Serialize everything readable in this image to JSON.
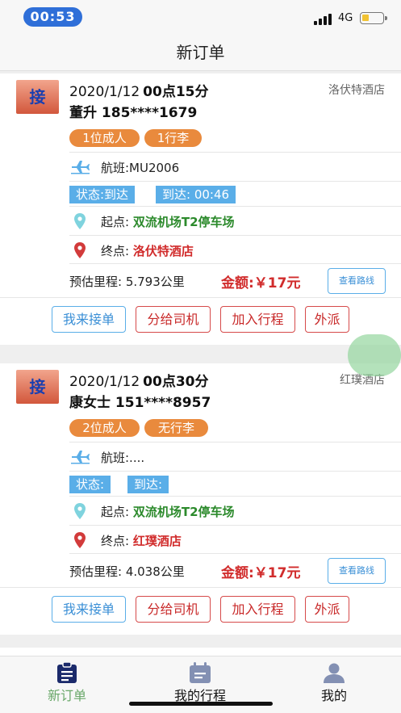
{
  "status_bar": {
    "time": "00:53",
    "network": "4G"
  },
  "nav": {
    "title": "新订单"
  },
  "orders": [
    {
      "badge": "接",
      "date": "2020/1/12",
      "time": "00点15分",
      "hotel": "洛伏特酒店",
      "customer": "董升 185****1679",
      "tags": [
        "1位成人",
        "1行李"
      ],
      "flight": "航班:MU2006",
      "status": "状态:到达",
      "arrival": "到达: 00:46",
      "from_label": "起点:",
      "from": "双流机场T2停车场",
      "to_label": "终点:",
      "to": "洛伏特酒店",
      "est_distance": "预估里程: 5.793公里",
      "amount": "金额:￥17元",
      "route_btn": "查看路线",
      "actions": [
        "我来接单",
        "分给司机",
        "加入行程",
        "外派"
      ]
    },
    {
      "badge": "接",
      "date": "2020/1/12",
      "time": "00点30分",
      "hotel": "红璞酒店",
      "customer": "康女士 151****8957",
      "tags": [
        "2位成人",
        "无行李"
      ],
      "flight": "航班:....",
      "status": "状态:",
      "arrival": "到达:",
      "from_label": "起点:",
      "from": "双流机场T2停车场",
      "to_label": "终点:",
      "to": "红璞酒店",
      "est_distance": "预估里程: 4.038公里",
      "amount": "金额:￥17元",
      "route_btn": "查看路线",
      "actions": [
        "我来接单",
        "分给司机",
        "加入行程",
        "外派"
      ]
    }
  ],
  "tabbar": {
    "tabs": [
      {
        "label": "新订单",
        "icon": "clipboard-icon",
        "active": true
      },
      {
        "label": "我的行程",
        "icon": "calendar-icon",
        "active": false
      },
      {
        "label": "我的",
        "icon": "person-icon",
        "active": false
      }
    ]
  },
  "colors": {
    "accent_blue": "#5aaee8",
    "tag_orange": "#e98a3d",
    "amount_red": "#d12c2c",
    "location_green": "#2c8a2c",
    "tab_active": "#1b2a6b"
  }
}
